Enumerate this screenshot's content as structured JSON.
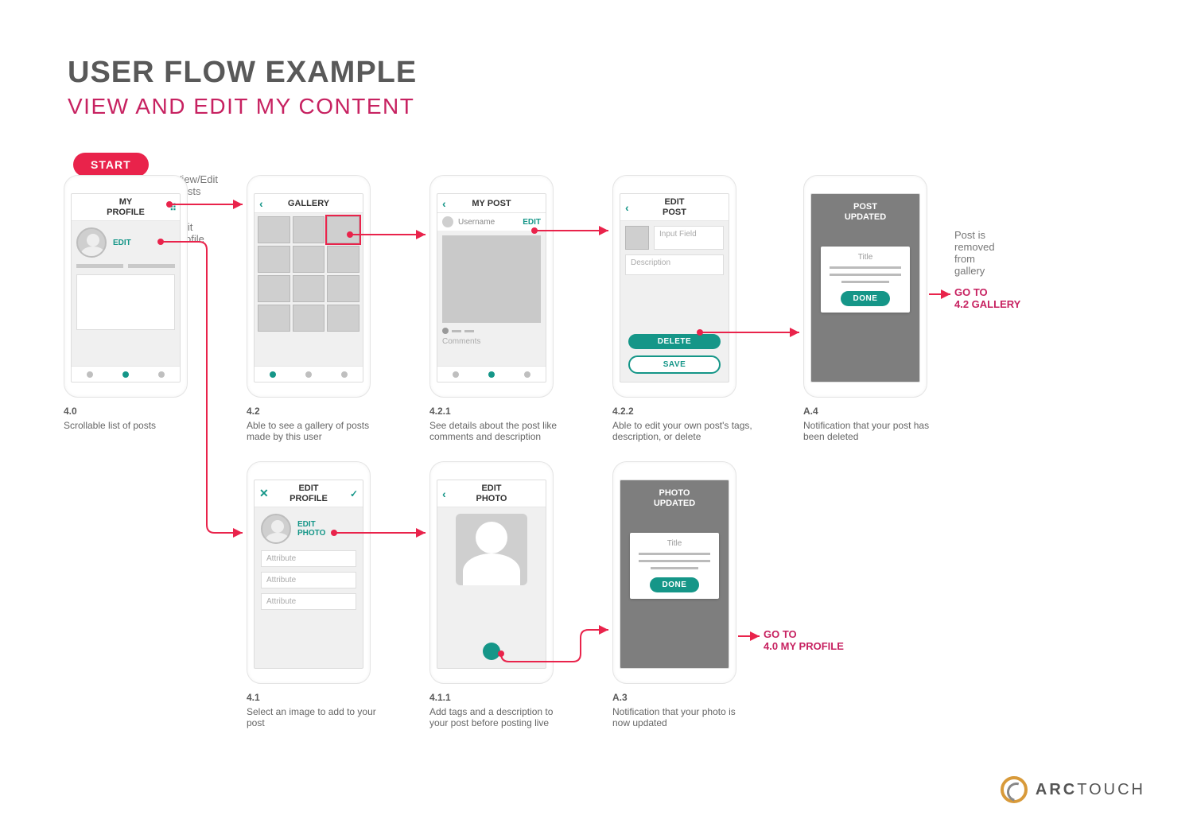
{
  "header": {
    "title": "USER FLOW EXAMPLE",
    "subtitle": "VIEW AND EDIT MY CONTENT"
  },
  "start": "START",
  "annotations": {
    "view_edit_posts": "View/Edit\nPosts",
    "edit_profile": "Edit\nProfile",
    "post_removed": "Post is\nremoved\nfrom\ngallery",
    "goto_gallery": "GO TO\n4.2 GALLERY",
    "goto_profile": "GO TO\n4.0 MY PROFILE"
  },
  "screens": {
    "s40": {
      "num": "4.0",
      "desc": "Scrollable list of posts",
      "title": "MY\nPROFILE",
      "edit": "EDIT"
    },
    "s42": {
      "num": "4.2",
      "desc": "Able to see a gallery of posts made by this user",
      "title": "GALLERY"
    },
    "s421": {
      "num": "4.2.1",
      "desc": "See details about the post like comments and description",
      "title": "MY POST",
      "username": "Username",
      "edit": "EDIT",
      "comments": "Comments"
    },
    "s422": {
      "num": "4.2.2",
      "desc": "Able to edit your own post's tags, description, or delete",
      "title": "EDIT\nPOST",
      "input": "Input Field",
      "desc_field": "Description",
      "delete": "DELETE",
      "save": "SAVE"
    },
    "a4": {
      "num": "A.4",
      "desc": "Notification that your post has been deleted",
      "title": "POST\nUPDATED",
      "card_title": "Title",
      "done": "DONE"
    },
    "s41": {
      "num": "4.1",
      "desc": "Select an image to add to your post",
      "title": "EDIT\nPROFILE",
      "edit_photo": "EDIT\nPHOTO",
      "attribute": "Attribute"
    },
    "s411": {
      "num": "4.1.1",
      "desc": "Add tags and a description to your post before posting live",
      "title": "EDIT\nPHOTO"
    },
    "a3": {
      "num": "A.3",
      "desc": "Notification that your photo is now updated",
      "title": "PHOTO\nUPDATED",
      "card_title": "Title",
      "done": "DONE"
    }
  },
  "logo": "ARCTOUCH"
}
